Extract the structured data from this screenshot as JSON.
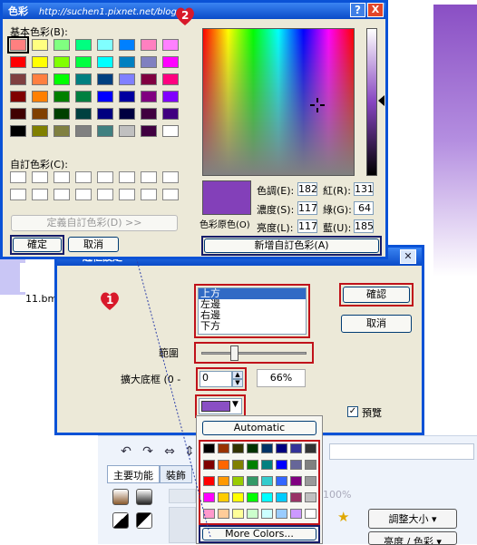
{
  "background": {
    "file_label": "11.bmp",
    "ribbon": {
      "tabs": [
        "主要功能",
        "裝飾"
      ],
      "percent": "100%",
      "resize_label": "調整大小",
      "brightness_label": "亮度 / 色彩"
    }
  },
  "color_dialog": {
    "title": "色彩",
    "watermark": "http://suchen1.pixnet.net/blog/",
    "badge": "2",
    "basic_label": "基本色彩(B):",
    "custom_label": "自訂色彩(C):",
    "define_custom_button": "定義自訂色彩(D) >>",
    "ok_button": "確定",
    "cancel_button": "取消",
    "add_custom_button": "新增自訂色彩(A)",
    "color_solid_label": "色彩原色(O)",
    "fields": {
      "hue_label": "色調(E):",
      "hue": "182",
      "sat_label": "濃度(S):",
      "sat": "117",
      "lum_label": "亮度(L):",
      "lum": "117",
      "red_label": "紅(R):",
      "red": "131",
      "green_label": "綠(G):",
      "green": "64",
      "blue_label": "藍(U):",
      "blue": "185"
    },
    "preview_color": "#8340b9",
    "help_icon": "?",
    "close_icon": "X",
    "basic_colors": [
      "#ff8080",
      "#ffff80",
      "#80ff80",
      "#00ff80",
      "#80ffff",
      "#0080ff",
      "#ff80c0",
      "#ff80ff",
      "#ff0000",
      "#ffff00",
      "#80ff00",
      "#00ff40",
      "#00ffff",
      "#0080c0",
      "#8080c0",
      "#ff00ff",
      "#804040",
      "#ff8040",
      "#00ff00",
      "#008080",
      "#004080",
      "#8080ff",
      "#800040",
      "#ff0080",
      "#800000",
      "#ff8000",
      "#008000",
      "#008040",
      "#0000ff",
      "#0000a0",
      "#800080",
      "#8000ff",
      "#400000",
      "#804000",
      "#004000",
      "#004040",
      "#000080",
      "#000040",
      "#400040",
      "#400080",
      "#000000",
      "#808000",
      "#808040",
      "#808080",
      "#408080",
      "#c0c0c0",
      "#400040",
      "#ffffff"
    ]
  },
  "edge_dialog": {
    "title": "邊框設定",
    "badge": "1",
    "position_options": [
      "上方",
      "左邊",
      "右邊",
      "下方"
    ],
    "selected_position": "上方",
    "ok_button": "確認",
    "cancel_button": "取消",
    "range_label": "範圍",
    "expand_label": "擴大底框 (0 -",
    "expand_value": "0",
    "percent_value": "66%",
    "preview_label": "預覽",
    "preview_checked": true,
    "selected_color": "#8a4fc4"
  },
  "palette_dropdown": {
    "automatic_label": "Automatic",
    "more_colors_label": "More Colors...",
    "colors": [
      "#000000",
      "#993300",
      "#333300",
      "#003300",
      "#003366",
      "#000080",
      "#333399",
      "#333333",
      "#800000",
      "#ff6600",
      "#808000",
      "#008000",
      "#008080",
      "#0000ff",
      "#666699",
      "#808080",
      "#ff0000",
      "#ff9900",
      "#99cc00",
      "#339966",
      "#33cccc",
      "#3366ff",
      "#800080",
      "#999999",
      "#ff00ff",
      "#ffcc00",
      "#ffff00",
      "#00ff00",
      "#00ffff",
      "#00ccff",
      "#993366",
      "#c0c0c0",
      "#ff99cc",
      "#ffcc99",
      "#ffff99",
      "#ccffcc",
      "#ccffff",
      "#99ccff",
      "#cc99ff",
      "#ffffff"
    ]
  }
}
